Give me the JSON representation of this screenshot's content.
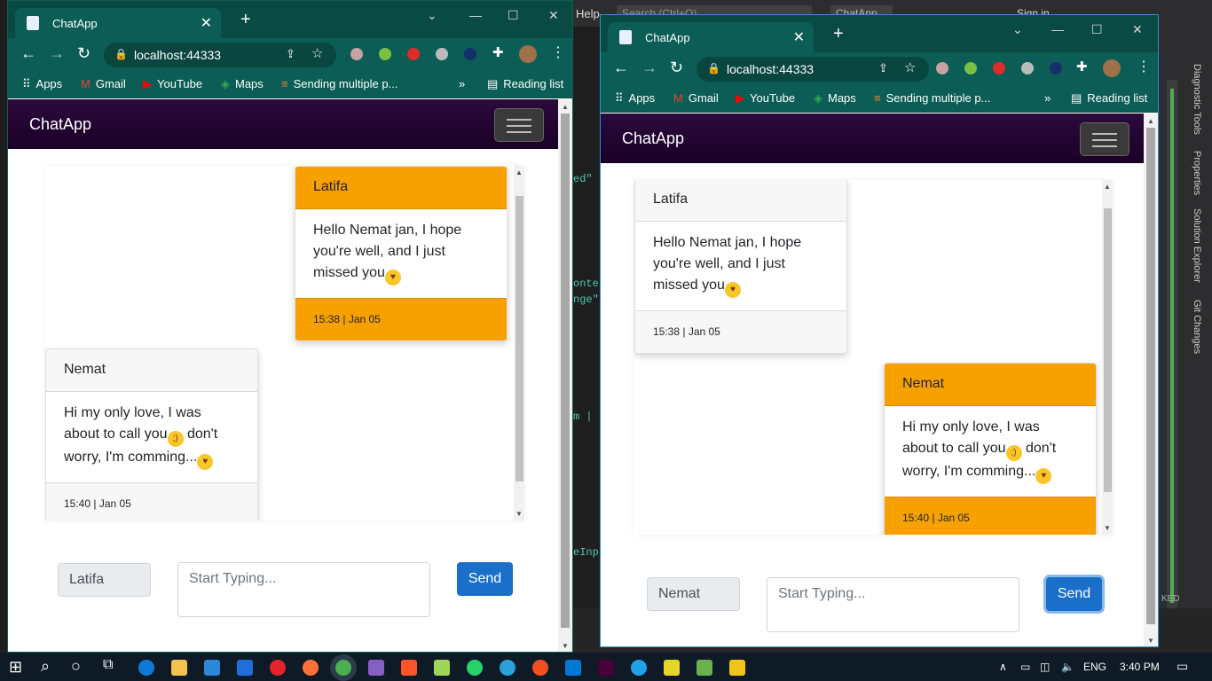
{
  "vs": {
    "menu_help": "Help",
    "search_placeholder": "Search (Ctrl+Q)",
    "chat_label": "ChatApp",
    "sign_in": "Sign in",
    "code_fragments": [
      "ed\"",
      "onte",
      "nge\"",
      "m |",
      "eInp"
    ],
    "side_tabs": [
      "Diagnostic Tools",
      "Properties",
      "Solution Explorer",
      "Git Changes"
    ],
    "status": "KED",
    "notif_count": "2"
  },
  "windows": [
    {
      "tab_title": "ChatApp",
      "url": "localhost:44333",
      "bookmarks": [
        "Apps",
        "Gmail",
        "YouTube",
        "Maps",
        "Sending multiple p...",
        "»",
        "Reading list"
      ],
      "brand": "ChatApp",
      "messages": [
        {
          "sender": "Latifa",
          "text": "Hello Nemat jan, I hope you're well, and I just missed you",
          "emoji": "😘",
          "time": "15:38 | Jan 05",
          "style": "orange"
        },
        {
          "sender": "Nemat",
          "text": "Hi my only love, I was about to call you",
          "emoji1": "😉",
          "text2": " don't worry, I'm comming...",
          "emoji2": "😍",
          "time": "15:40 | Jan 05",
          "style": "gray"
        }
      ],
      "name": "Latifa",
      "placeholder": "Start Typing...",
      "send": "Send"
    },
    {
      "tab_title": "ChatApp",
      "url": "localhost:44333",
      "bookmarks": [
        "Apps",
        "Gmail",
        "YouTube",
        "Maps",
        "Sending multiple p...",
        "»",
        "Reading list"
      ],
      "brand": "ChatApp",
      "messages": [
        {
          "sender": "Latifa",
          "text": "Hello Nemat jan, I hope you're well, and I just missed you",
          "emoji": "😘",
          "time": "15:38 | Jan 05",
          "style": "gray"
        },
        {
          "sender": "Nemat",
          "text": "Hi my only love, I was about to call you",
          "emoji1": "😉",
          "text2": " don't worry, I'm comming...",
          "emoji2": "😍",
          "time": "15:40 | Jan 05",
          "style": "orange"
        }
      ],
      "name": "Nemat",
      "placeholder": "Start Typing...",
      "send": "Send"
    }
  ],
  "taskbar": {
    "lang": "ENG",
    "time": "3:40 PM"
  }
}
